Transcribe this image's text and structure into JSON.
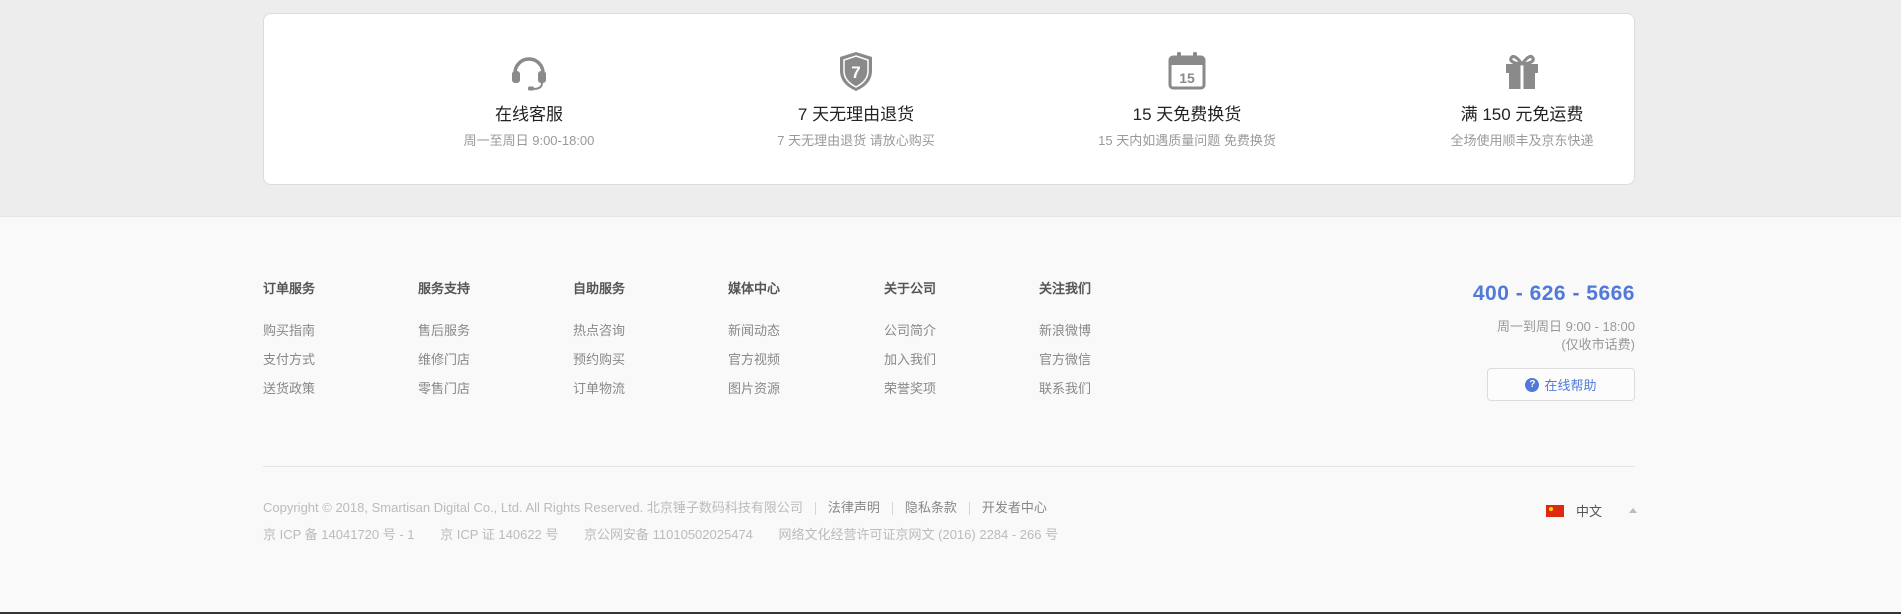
{
  "services": [
    {
      "icon": "headset-icon",
      "title": "在线客服",
      "desc": "周一至周日 9:00-18:00"
    },
    {
      "icon": "shield-seven-icon",
      "title": "7 天无理由退货",
      "desc": "7 天无理由退货 请放心购买",
      "badge": "7"
    },
    {
      "icon": "calendar-15-icon",
      "title": "15 天免费换货",
      "desc": "15 天内如遇质量问题 免费换货",
      "badge": "15"
    },
    {
      "icon": "gift-icon",
      "title": "满 150 元免运费",
      "desc": "全场使用顺丰及京东快递"
    }
  ],
  "footer": {
    "columns": [
      {
        "title": "订单服务",
        "links": [
          "购买指南",
          "支付方式",
          "送货政策"
        ]
      },
      {
        "title": "服务支持",
        "links": [
          "售后服务",
          "维修门店",
          "零售门店"
        ]
      },
      {
        "title": "自助服务",
        "links": [
          "热点咨询",
          "预约购买",
          "订单物流"
        ]
      },
      {
        "title": "媒体中心",
        "links": [
          "新闻动态",
          "官方视频",
          "图片资源"
        ]
      },
      {
        "title": "关于公司",
        "links": [
          "公司简介",
          "加入我们",
          "荣誉奖项"
        ]
      },
      {
        "title": "关注我们",
        "links": [
          "新浪微博",
          "官方微信",
          "联系我们"
        ]
      }
    ],
    "contact": {
      "phone": "400 - 626 - 5666",
      "hours": "周一到周日 9:00 - 18:00",
      "note": "(仅收市话费)",
      "help_label": "在线帮助"
    },
    "copyright": "Copyright © 2018, Smartisan Digital Co., Ltd. All Rights Reserved. 北京锤子数码科技有限公司",
    "legal_links": [
      "法律声明",
      "隐私条款",
      "开发者中心"
    ],
    "icp": [
      "京 ICP 备 14041720 号 - 1",
      "京 ICP 证 140622 号",
      "京公网安备 11010502025474",
      "网络文化经营许可证京网文 (2016) 2284 - 266 号"
    ],
    "language": "中文"
  },
  "colors": {
    "accent": "#5079d9",
    "icon_gray": "#8a8a8a"
  }
}
